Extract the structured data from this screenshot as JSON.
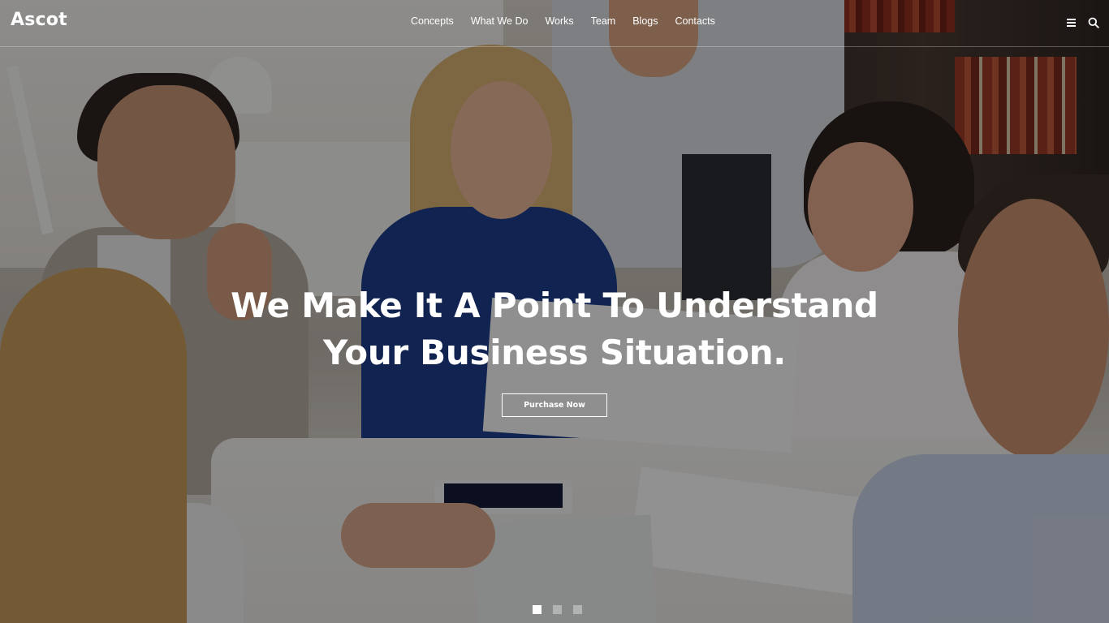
{
  "brand": {
    "logo": "Ascot"
  },
  "nav": {
    "items": [
      {
        "label": "Concepts"
      },
      {
        "label": "What We Do"
      },
      {
        "label": "Works"
      },
      {
        "label": "Team"
      },
      {
        "label": "Blogs"
      },
      {
        "label": "Contacts"
      }
    ]
  },
  "header_icons": [
    "menu-icon",
    "search-icon"
  ],
  "hero": {
    "headline_line1": "We Make It A Point To Understand",
    "headline_line2": "Your Business Situation.",
    "cta_label": "Purchase Now",
    "slides": {
      "count": 3,
      "active_index": 0
    }
  }
}
